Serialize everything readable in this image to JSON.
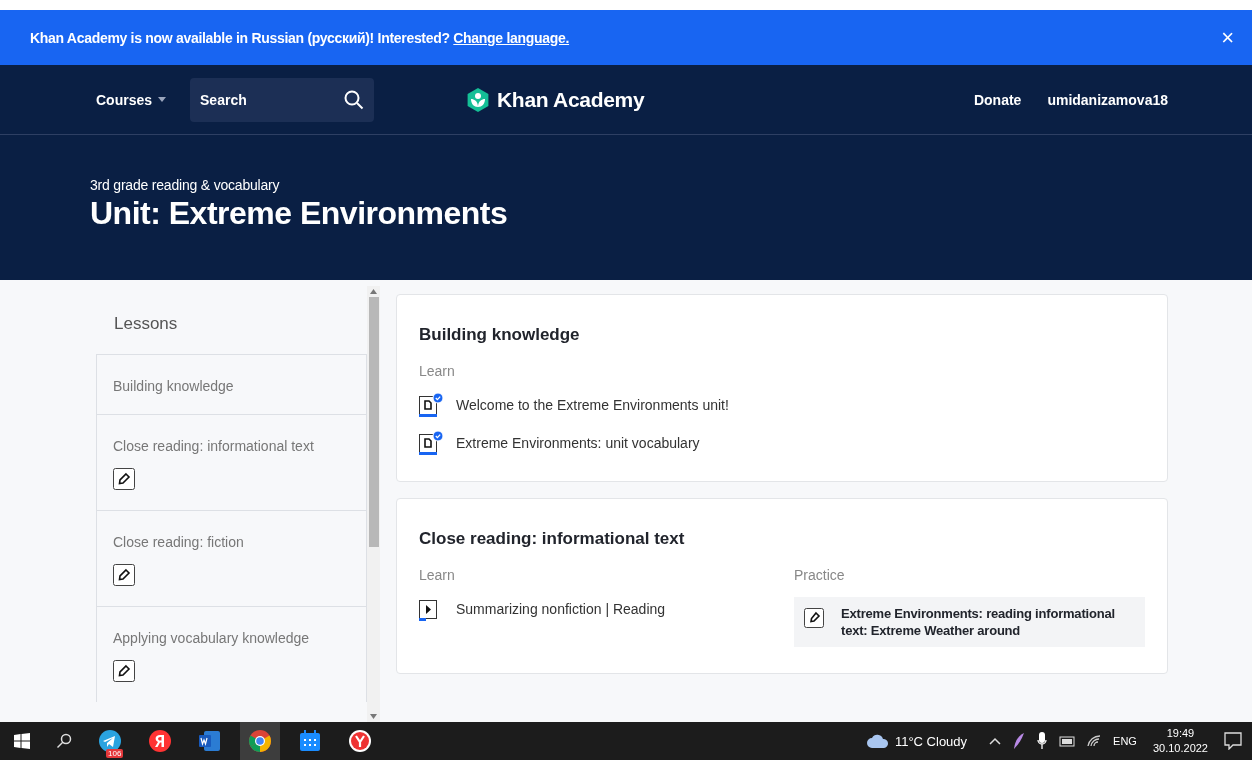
{
  "banner": {
    "message": "Khan Academy is now available in Russian (русский)! Interested?",
    "link": "Change language.",
    "close": "×"
  },
  "nav": {
    "courses": "Courses",
    "search_placeholder": "Search",
    "logo": "Khan Academy",
    "links": [
      "Donate",
      "umidanizamova18"
    ]
  },
  "header": {
    "breadcrumb": "3rd grade reading & vocabulary",
    "title": "Unit: Extreme Environments"
  },
  "lessons": {
    "title": "Lessons",
    "items": [
      {
        "label": "Building knowledge",
        "kind": "plain"
      },
      {
        "label": "Close reading: informational text",
        "kind": "exercise"
      },
      {
        "label": "Close reading: fiction",
        "kind": "exercise"
      },
      {
        "label": "Applying vocabulary knowledge",
        "kind": "exercise"
      }
    ]
  },
  "cards": [
    {
      "title": "Building knowledge",
      "sections": [
        {
          "heading": "Learn",
          "items": [
            {
              "kind": "article",
              "text": "Welcome to the Extreme Environments unit!",
              "completed": true
            },
            {
              "kind": "article",
              "text": "Extreme Environments: unit vocabulary",
              "completed": true
            }
          ]
        }
      ]
    },
    {
      "title": "Close reading: informational text",
      "sections": [
        {
          "heading": "Learn",
          "items": [
            {
              "kind": "video",
              "text": "Summarizing nonfiction | Reading",
              "completed": false
            }
          ]
        },
        {
          "heading": "Practice",
          "items": [
            {
              "kind": "exercise",
              "text": "Extreme Environments: reading informational text: Extreme Weather around",
              "completed": false
            }
          ]
        }
      ]
    }
  ],
  "taskbar": {
    "apps": [
      {
        "kind": "telegram",
        "badge": "106",
        "selected": false
      },
      {
        "kind": "yandex",
        "selected": false
      },
      {
        "kind": "word",
        "selected": false
      },
      {
        "kind": "chrome",
        "selected": true
      },
      {
        "kind": "calendar",
        "selected": false
      },
      {
        "kind": "ybrowser",
        "selected": false
      }
    ],
    "weather": "11°C Cloudy",
    "language": "ENG",
    "time": "19:49",
    "date": "30.10.2022"
  }
}
